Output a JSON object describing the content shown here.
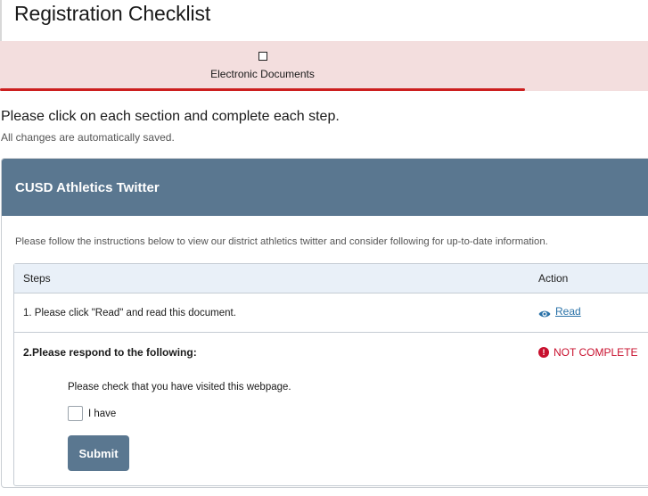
{
  "page": {
    "title": "Registration Checklist",
    "instructions": "Please click on each section and complete each step.",
    "autosave_note": "All changes are automatically saved."
  },
  "tabs": [
    {
      "label": "Electronic Documents",
      "icon": "checkbox-outline-icon",
      "active": true
    }
  ],
  "section": {
    "title": "CUSD Athletics Twitter",
    "description": "Please follow the instructions below to view our district athletics twitter and consider following for up-to-date information.",
    "table": {
      "headers": {
        "steps": "Steps",
        "action": "Action"
      },
      "step1": {
        "text": "1. Please click \"Read\" and read this document.",
        "action_label": "Read",
        "action_icon": "eye-icon"
      },
      "step2": {
        "text": "2.Please respond to the following:",
        "status": "NOT COMPLETE",
        "status_icon": "alert-icon",
        "question": "Please check that you have visited this webpage.",
        "checkbox_label": "I have",
        "submit_label": "Submit"
      }
    }
  },
  "colors": {
    "header_bg": "#5a7790",
    "tab_bg": "#f3dede",
    "tab_underline": "#cc1f1f",
    "link": "#2a72a8",
    "status_red": "#c8102e"
  }
}
